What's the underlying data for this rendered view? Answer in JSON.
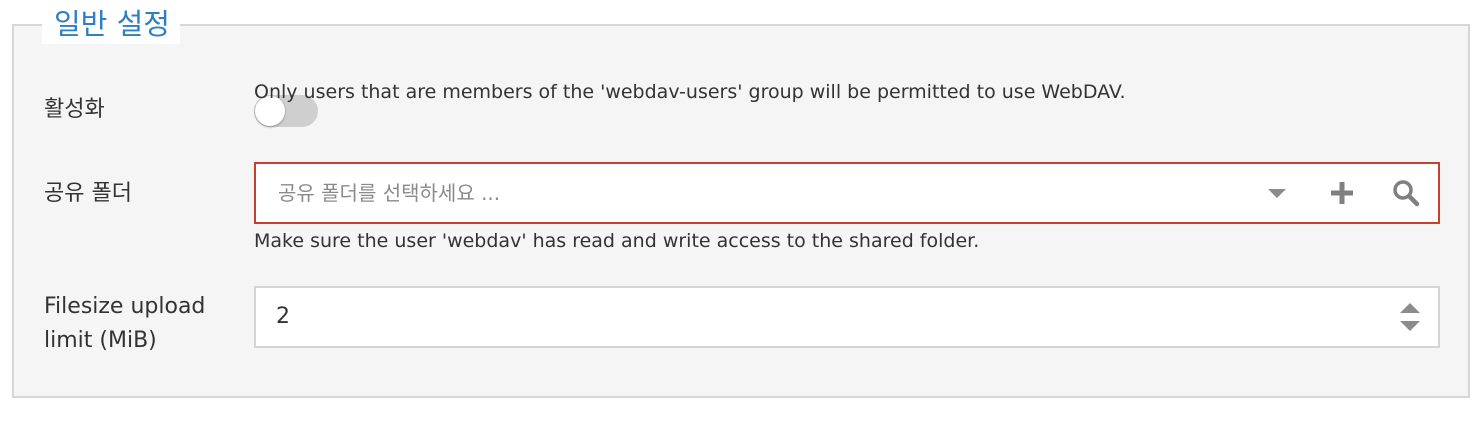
{
  "section": {
    "legend": "일반 설정"
  },
  "enable": {
    "label": "활성화",
    "help": "Only users that are members of the 'webdav-users' group will be permitted to use WebDAV.",
    "enabled": false
  },
  "shared_folder": {
    "label": "공유 폴더",
    "placeholder": "공유 폴더를 선택하세요 ...",
    "help": "Make sure the user 'webdav' has read and write access to the shared folder.",
    "icons": [
      "chevron-down-icon",
      "plus-icon",
      "search-icon"
    ]
  },
  "upload_limit": {
    "label_line1": "Filesize upload",
    "label_line2": "limit (MiB)",
    "value": "2",
    "icons": [
      "spinner-up-icon",
      "spinner-down-icon"
    ]
  },
  "colors": {
    "legend": "#2d7fc3",
    "error_border": "#c8402d",
    "panel_bg": "#f5f5f5"
  }
}
